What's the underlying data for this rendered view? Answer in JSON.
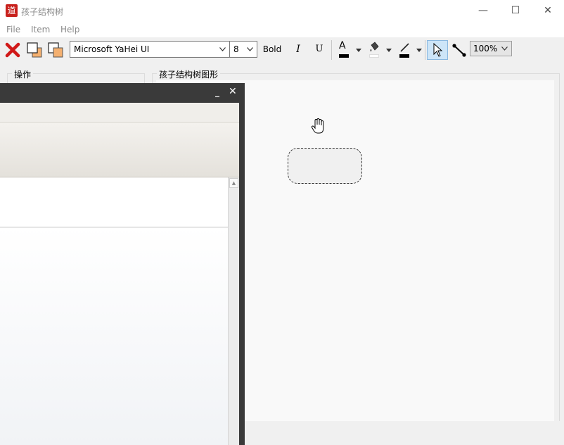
{
  "window": {
    "title": "孩子结构树",
    "app_icon_glyph": "道",
    "minimize_glyph": "—",
    "maximize_glyph": "☐",
    "close_glyph": "✕"
  },
  "menu": {
    "items": [
      {
        "label": "File"
      },
      {
        "label": "Item"
      },
      {
        "label": "Help"
      }
    ]
  },
  "toolbar": {
    "delete_icon": "red-x-icon",
    "font_name": "Microsoft YaHei UI",
    "font_size": "8",
    "bold_label": "Bold",
    "italic_label": "I",
    "underline_label": "U",
    "font_color_label": "A",
    "zoom": "100%",
    "colors": {
      "font_color": "#000000",
      "fill_color": "#ffffff",
      "line_color": "#000000",
      "delete_red": "#d01818",
      "pointer_active_bg": "#cde5f8"
    }
  },
  "panels": {
    "operations_label": "操作",
    "diagram_label": "孩子结构树图形"
  },
  "overlay_window": {
    "minimize_glyph": "_",
    "close_glyph": "✕",
    "scroll_up_glyph": "▲"
  }
}
